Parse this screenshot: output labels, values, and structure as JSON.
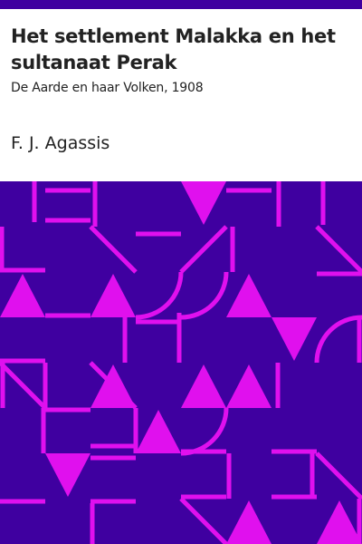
{
  "colors": {
    "band": "#3f00a0",
    "pattern_background": "#3f00a0",
    "pattern_foreground": "#e010ee",
    "text": "#222222"
  },
  "cover": {
    "title": "Het settlement Malakka en het sultanaat Perak",
    "subtitle": "De Aarde en haar Volken, 1908",
    "author": "F. J. Agassis"
  }
}
